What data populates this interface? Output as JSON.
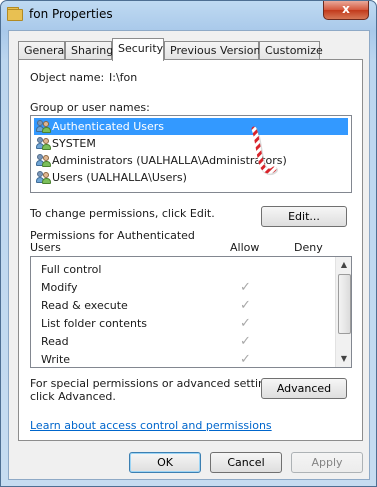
{
  "window": {
    "title": "fon Properties",
    "close_glyph": "x"
  },
  "tabs": [
    {
      "label": "General",
      "active": false
    },
    {
      "label": "Sharing",
      "active": false
    },
    {
      "label": "Security",
      "active": true
    },
    {
      "label": "Previous Versions",
      "active": false
    },
    {
      "label": "Customize",
      "active": false
    }
  ],
  "object": {
    "label": "Object name:",
    "value": "I:\\fon"
  },
  "groups": {
    "label": "Group or user names:",
    "items": [
      {
        "label": "Authenticated Users",
        "selected": true,
        "icon": "user-group-icon"
      },
      {
        "label": "SYSTEM",
        "selected": false,
        "icon": "user-group-icon"
      },
      {
        "label": "Administrators (UALHALLA\\Administrators)",
        "selected": false,
        "icon": "user-group-icon"
      },
      {
        "label": "Users (UALHALLA\\Users)",
        "selected": false,
        "icon": "user-group-icon"
      }
    ]
  },
  "change_text": "To change permissions, click Edit.",
  "edit_label": "Edit...",
  "permissions": {
    "title_line1": "Permissions for Authenticated",
    "title_line2": "Users",
    "allow_header": "Allow",
    "deny_header": "Deny",
    "rows": [
      {
        "name": "Full control",
        "allow": "",
        "deny": ""
      },
      {
        "name": "Modify",
        "allow": "✓",
        "deny": ""
      },
      {
        "name": "Read & execute",
        "allow": "✓",
        "deny": ""
      },
      {
        "name": "List folder contents",
        "allow": "✓",
        "deny": ""
      },
      {
        "name": "Read",
        "allow": "✓",
        "deny": ""
      },
      {
        "name": "Write",
        "allow": "✓",
        "deny": ""
      }
    ]
  },
  "special": {
    "line1": "For special permissions or advanced settings,",
    "line2": "click Advanced.",
    "advanced_label": "Advanced"
  },
  "learn_link": "Learn about access control and permissions",
  "footer": {
    "ok": "OK",
    "cancel": "Cancel",
    "apply": "Apply"
  },
  "colors": {
    "selection": "#3399ff",
    "link": "#0066cc",
    "close": "#c23a1c"
  }
}
